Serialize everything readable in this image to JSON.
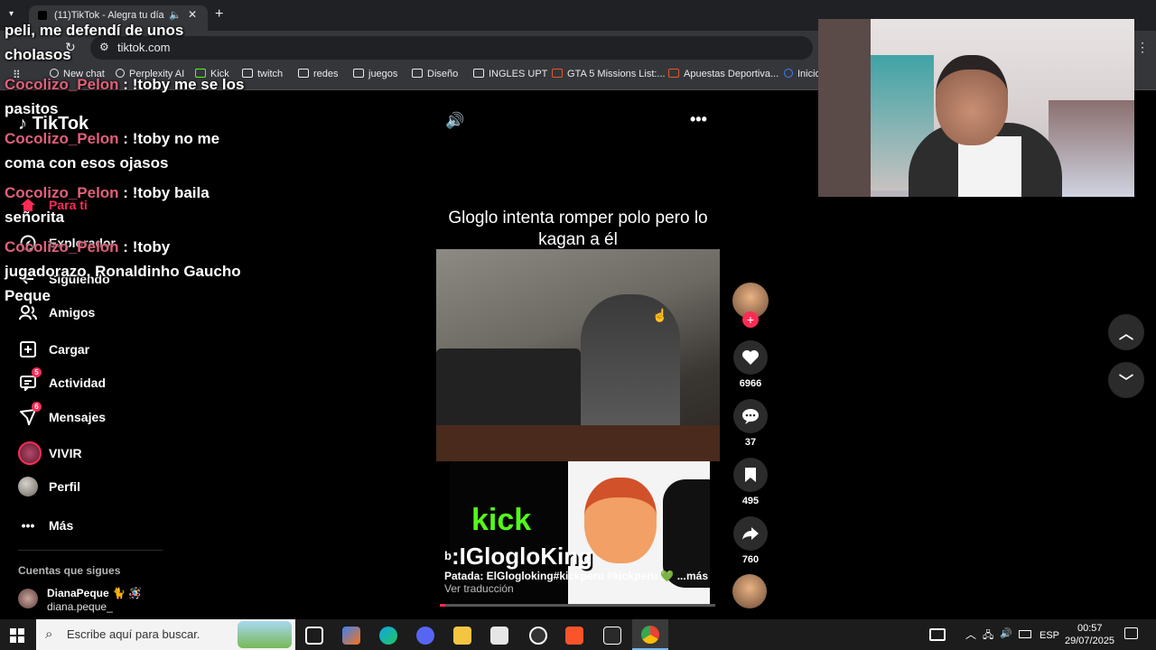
{
  "browser": {
    "tab_title": "(11)TikTok - Alegra tu día",
    "url": "tiktok.com",
    "bookmarks": [
      "New chat",
      "Perplexity AI",
      "Kick",
      "twitch",
      "redes",
      "juegos",
      "Diseño",
      "INGLES UPT",
      "GTA 5 Missions List:...",
      "Apuestas Deportiva...",
      "Inicio"
    ]
  },
  "sidebar": {
    "logo": "TikTok",
    "items": [
      {
        "label": "Para ti"
      },
      {
        "label": "Explorador"
      },
      {
        "label": "Siguiendo"
      },
      {
        "label": "Amigos"
      },
      {
        "label": "Cargar"
      },
      {
        "label": "Actividad",
        "badge": "5"
      },
      {
        "label": "Mensajes",
        "badge": "6"
      },
      {
        "label": "VIVIR"
      },
      {
        "label": "Perfil"
      },
      {
        "label": "Más"
      }
    ],
    "following_heading": "Cuentas que sigues",
    "following": [
      {
        "name": "DianaPeque 🐈 🪅",
        "handle": "diana.peque_"
      }
    ]
  },
  "chat": [
    {
      "user": "",
      "text": "peli, me defendí de unos cholasos"
    },
    {
      "user": "Cocolizo_Pelon",
      "text": "!toby me se los pasitos"
    },
    {
      "user": "Cocolizo_Pelon",
      "text": "!toby no me coma con esos ojasos"
    },
    {
      "user": "Cocolizo_Pelon",
      "text": "!toby baila señorita"
    },
    {
      "user": "Cocolizo_Pelon",
      "text": "!toby jugadorazo, Ronaldinho Gaucho Peque"
    }
  ],
  "video": {
    "title": "Gloglo intenta romper polo pero lo kagan a él",
    "overlay_kick": "kick",
    "overlay_channel": ":IGlogloKing",
    "author_prefix": "b",
    "caption": "Patada: ElGlogloking#kickperu  #kickperu 💚  ...",
    "more": "más",
    "translate": "Ver traducción"
  },
  "actions": {
    "likes": "6966",
    "comments": "37",
    "saves": "495",
    "shares": "760"
  },
  "taskbar": {
    "search_placeholder": "Escribe aquí para buscar.",
    "lang": "ESP",
    "time": "00:57",
    "date": "29/07/2025"
  },
  "colors": {
    "accent": "#fe2c55",
    "kick_green": "#53fc18",
    "chat_name": "#e0607a"
  }
}
